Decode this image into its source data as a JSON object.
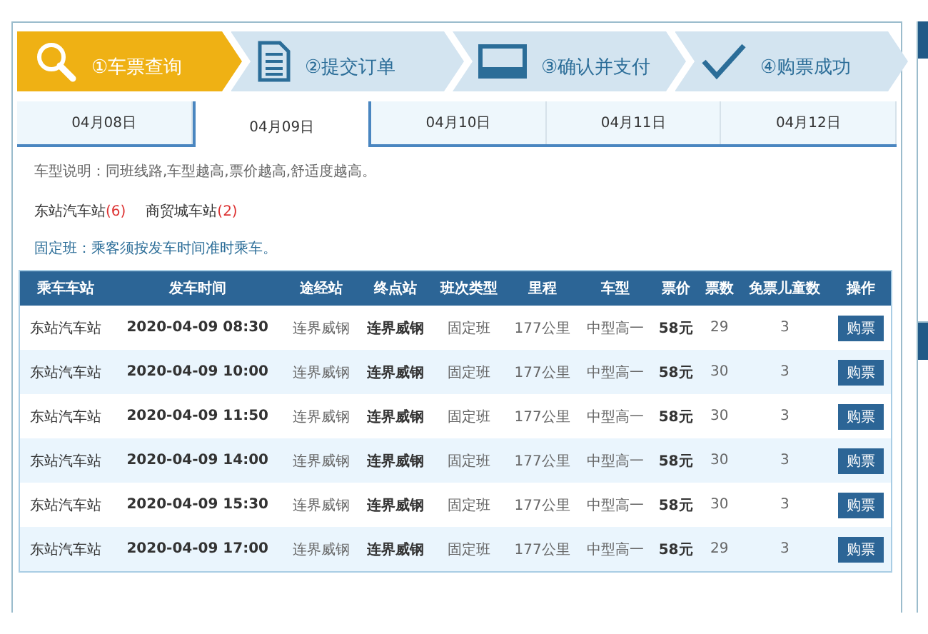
{
  "steps": [
    {
      "label": "①车票查询",
      "kind": "search",
      "selected": true
    },
    {
      "label": "②提交订单",
      "kind": "document",
      "selected": false
    },
    {
      "label": "③确认并支付",
      "kind": "screen",
      "selected": false
    },
    {
      "label": "④购票成功",
      "kind": "check",
      "selected": false
    }
  ],
  "date_tabs": [
    {
      "label": "04月08日",
      "selected": false
    },
    {
      "label": "04月09日",
      "selected": true
    },
    {
      "label": "04月10日",
      "selected": false
    },
    {
      "label": "04月11日",
      "selected": false
    },
    {
      "label": "04月12日",
      "selected": false
    }
  ],
  "vehicle_note": "车型说明：同班线路,车型越高,票价越高,舒适度越高。",
  "stations": [
    {
      "name": "东站汽车站",
      "count": "(6)"
    },
    {
      "name": "商贸城车站",
      "count": "(2)"
    }
  ],
  "fixed_note": "固定班：乘客须按发车时间准时乘车。",
  "table": {
    "columns": [
      "乘车车站",
      "发车时间",
      "途经站",
      "终点站",
      "班次类型",
      "里程",
      "车型",
      "票价",
      "票数",
      "免票儿童数",
      "操作"
    ],
    "rows": [
      {
        "cells": [
          "东站汽车站",
          "2020-04-09 08:30",
          "连界威钢",
          "连界威钢",
          "固定班",
          "177公里",
          "中型高一",
          "58元",
          "29",
          "3"
        ],
        "action": "购票"
      },
      {
        "cells": [
          "东站汽车站",
          "2020-04-09 10:00",
          "连界威钢",
          "连界威钢",
          "固定班",
          "177公里",
          "中型高一",
          "58元",
          "30",
          "3"
        ],
        "action": "购票"
      },
      {
        "cells": [
          "东站汽车站",
          "2020-04-09 11:50",
          "连界威钢",
          "连界威钢",
          "固定班",
          "177公里",
          "中型高一",
          "58元",
          "30",
          "3"
        ],
        "action": "购票"
      },
      {
        "cells": [
          "东站汽车站",
          "2020-04-09 14:00",
          "连界威钢",
          "连界威钢",
          "固定班",
          "177公里",
          "中型高一",
          "58元",
          "30",
          "3"
        ],
        "action": "购票"
      },
      {
        "cells": [
          "东站汽车站",
          "2020-04-09 15:30",
          "连界威钢",
          "连界威钢",
          "固定班",
          "177公里",
          "中型高一",
          "58元",
          "30",
          "3"
        ],
        "action": "购票"
      },
      {
        "cells": [
          "东站汽车站",
          "2020-04-09 17:00",
          "连界威钢",
          "连界威钢",
          "固定班",
          "177公里",
          "中型高一",
          "58元",
          "29",
          "3"
        ],
        "action": "购票"
      }
    ]
  }
}
